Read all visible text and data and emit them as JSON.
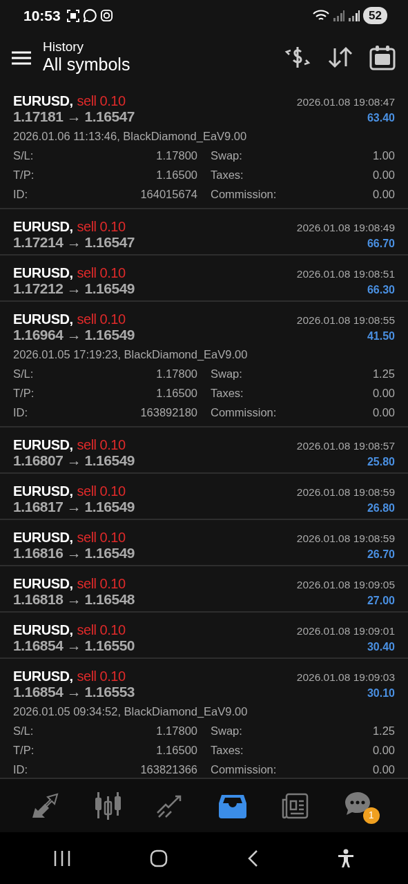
{
  "status_bar": {
    "time": "10:53",
    "battery": "52"
  },
  "header": {
    "title": "History",
    "subtitle": "All symbols"
  },
  "deals": [
    {
      "symbol": "EURUSD,",
      "trade": "sell 0.10",
      "kind": "sell",
      "prices": "1.17181 → 1.16547",
      "time": "2026.01.08 19:08:47",
      "profit": "63.40",
      "expanded": true,
      "comment": "2026.01.06 11:13:46, BlackDiamond_EaV9.00",
      "fields": [
        {
          "label": "S/L:",
          "value": "1.17800"
        },
        {
          "label": "Swap:",
          "value": "1.00"
        },
        {
          "label": "T/P:",
          "value": "1.16500"
        },
        {
          "label": "Taxes:",
          "value": "0.00"
        },
        {
          "label": "ID:",
          "value": "164015674"
        },
        {
          "label": "Commission:",
          "value": "0.00"
        }
      ]
    },
    {
      "symbol": "EURUSD,",
      "trade": "sell 0.10",
      "kind": "sell",
      "prices": "1.17214 → 1.16547",
      "time": "2026.01.08 19:08:49",
      "profit": "66.70",
      "expanded": false
    },
    {
      "symbol": "EURUSD,",
      "trade": "sell 0.10",
      "kind": "sell",
      "prices": "1.17212 → 1.16549",
      "time": "2026.01.08 19:08:51",
      "profit": "66.30",
      "expanded": false
    },
    {
      "symbol": "EURUSD,",
      "trade": "sell 0.10",
      "kind": "sell",
      "prices": "1.16964 → 1.16549",
      "time": "2026.01.08 19:08:55",
      "profit": "41.50",
      "expanded": true,
      "comment": "2026.01.05 17:19:23, BlackDiamond_EaV9.00",
      "fields": [
        {
          "label": "S/L:",
          "value": "1.17800"
        },
        {
          "label": "Swap:",
          "value": "1.25"
        },
        {
          "label": "T/P:",
          "value": "1.16500"
        },
        {
          "label": "Taxes:",
          "value": "0.00"
        },
        {
          "label": "ID:",
          "value": "163892180"
        },
        {
          "label": "Commission:",
          "value": "0.00"
        }
      ]
    },
    {
      "symbol": "EURUSD,",
      "trade": "sell 0.10",
      "kind": "sell",
      "prices": "1.16807 → 1.16549",
      "time": "2026.01.08 19:08:57",
      "profit": "25.80",
      "expanded": false
    },
    {
      "symbol": "EURUSD,",
      "trade": "sell 0.10",
      "kind": "sell",
      "prices": "1.16817 → 1.16549",
      "time": "2026.01.08 19:08:59",
      "profit": "26.80",
      "expanded": false
    },
    {
      "symbol": "EURUSD,",
      "trade": "sell 0.10",
      "kind": "sell",
      "prices": "1.16816 → 1.16549",
      "time": "2026.01.08 19:08:59",
      "profit": "26.70",
      "expanded": false
    },
    {
      "symbol": "EURUSD,",
      "trade": "sell 0.10",
      "kind": "sell",
      "prices": "1.16818 → 1.16548",
      "time": "2026.01.08 19:09:05",
      "profit": "27.00",
      "expanded": false
    },
    {
      "symbol": "EURUSD,",
      "trade": "sell 0.10",
      "kind": "sell",
      "prices": "1.16854 → 1.16550",
      "time": "2026.01.08 19:09:01",
      "profit": "30.40",
      "expanded": false
    },
    {
      "symbol": "EURUSD,",
      "trade": "sell 0.10",
      "kind": "sell",
      "prices": "1.16854 → 1.16553",
      "time": "2026.01.08 19:09:03",
      "profit": "30.10",
      "expanded": true,
      "comment": "2026.01.05 09:34:52, BlackDiamond_EaV9.00",
      "fields": [
        {
          "label": "S/L:",
          "value": "1.17800"
        },
        {
          "label": "Swap:",
          "value": "1.25"
        },
        {
          "label": "T/P:",
          "value": "1.16500"
        },
        {
          "label": "Taxes:",
          "value": "0.00"
        },
        {
          "label": "ID:",
          "value": "163821366"
        },
        {
          "label": "Commission:",
          "value": "0.00"
        }
      ]
    }
  ],
  "bottom_nav": [
    {
      "kind": "trade",
      "selected": false
    },
    {
      "kind": "quotes",
      "selected": false
    },
    {
      "kind": "chart",
      "selected": false
    },
    {
      "kind": "history",
      "selected": true
    },
    {
      "kind": "news",
      "selected": false
    },
    {
      "kind": "chat",
      "selected": false,
      "badge": "1"
    }
  ]
}
